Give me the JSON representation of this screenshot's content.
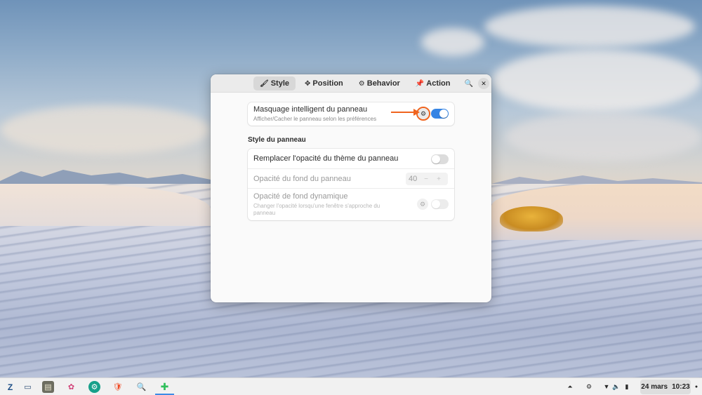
{
  "window": {
    "tabs": [
      {
        "icon": "brush-icon",
        "glyph": "🖌",
        "label": "Style",
        "active": true
      },
      {
        "icon": "position-icon",
        "glyph": "✥",
        "label": "Position",
        "active": false
      },
      {
        "icon": "behavior-gear-icon",
        "glyph": "⚙",
        "label": "Behavior",
        "active": false
      },
      {
        "icon": "pin-icon",
        "glyph": "📌",
        "label": "Action",
        "active": false
      }
    ],
    "search_glyph": "🔍",
    "close_glyph": "✕"
  },
  "smart_hide": {
    "title": "Masquage intelligent du panneau",
    "subtitle": "Afficher/Cacher le panneau selon les préférences",
    "enabled": true,
    "gear_glyph": "⚙"
  },
  "panel_style": {
    "section_title": "Style du panneau",
    "override_theme_opacity": {
      "title": "Remplacer l'opacité du thème du panneau",
      "enabled": false
    },
    "background_opacity": {
      "title": "Opacité du fond du panneau",
      "value": "40",
      "minus": "−",
      "plus": "+"
    },
    "dynamic_opacity": {
      "title": "Opacité de fond dynamique",
      "subtitle_line1": "Changer l'opacité lorsqu'une fenêtre s'approche du",
      "subtitle_line2": "panneau",
      "enabled": false,
      "gear_glyph": "⚙"
    }
  },
  "annotation": {
    "color": "#f0641e"
  },
  "taskbar": {
    "apps": [
      {
        "name": "zorin-menu-icon",
        "glyph": "Z"
      },
      {
        "name": "workspaces-icon",
        "glyph": "▭"
      },
      {
        "name": "files-icon",
        "glyph": "▤"
      },
      {
        "name": "software-icon",
        "glyph": "✿"
      },
      {
        "name": "settings-app-icon",
        "glyph": "⚙"
      },
      {
        "name": "brave-browser-icon",
        "glyph": "🛡"
      },
      {
        "name": "search-tool-icon",
        "glyph": "🔍"
      },
      {
        "name": "extensions-icon",
        "glyph": "✚"
      }
    ],
    "tray": {
      "up": "⏶",
      "gear": "⚙",
      "wifi": "▼",
      "sound": "🔈",
      "battery": "▮"
    },
    "date": "24 mars",
    "time": "10:23",
    "dot": "●"
  },
  "colors": {
    "accent": "#3584e4",
    "window_bg": "#fafafa",
    "taskbar_bg": "#f1f1f1"
  }
}
